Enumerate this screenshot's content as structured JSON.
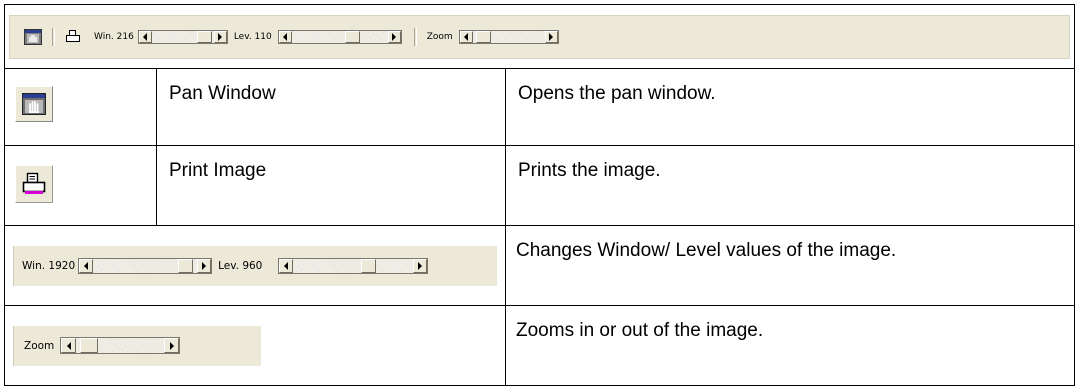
{
  "toolbar": {
    "win_label": "Win. 216",
    "lev_label": "Lev. 110",
    "zoom_label": "Zoom",
    "win_slider_position": 0.95,
    "lev_slider_position": 0.65,
    "zoom_slider_position": 0.05
  },
  "rows": [
    {
      "icon": "pan-window-icon",
      "name": "Pan Window",
      "description": "Opens the pan window."
    },
    {
      "icon": "print-icon",
      "name": "Print Image",
      "description": "Prints the image."
    },
    {
      "icon": "window-level-sliders",
      "name": "",
      "description": "Changes Window/ Level values of the image."
    },
    {
      "icon": "zoom-slider",
      "name": "",
      "description": "Zooms in or out of the image."
    }
  ],
  "window_level_widget": {
    "win_label": "Win. 1920",
    "lev_label": "Lev. 960",
    "win_slider_position": 0.95,
    "lev_slider_position": 0.65
  },
  "zoom_widget": {
    "zoom_label": "Zoom",
    "zoom_slider_position": 0.05
  }
}
